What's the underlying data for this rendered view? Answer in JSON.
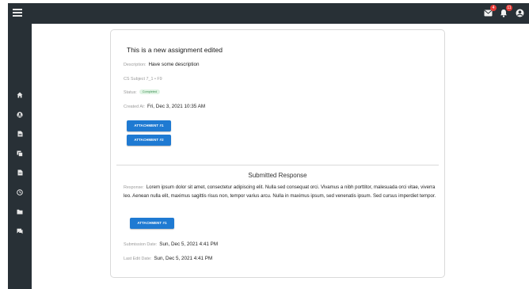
{
  "topbar": {
    "menu_icon": "hamburger-menu-icon",
    "icons": [
      {
        "name": "mail-icon",
        "badge": "4"
      },
      {
        "name": "bell-icon",
        "badge": "11"
      },
      {
        "name": "account-icon",
        "badge": ""
      }
    ],
    "background": "#283036"
  },
  "sidebar": {
    "items": [
      "home-icon",
      "account-circle-icon",
      "document-icon",
      "copy-icon",
      "file-icon",
      "clock-icon",
      "folder-icon",
      "chat-icon"
    ]
  },
  "assignment": {
    "title": "This is a new assignment edited",
    "description_label": "Description:",
    "description": "Have some description",
    "subject": "CS Subject 7_1 • F9",
    "status_label": "Status:",
    "status": "Completed",
    "created_label": "Created At:",
    "created": "Fri, Dec 3, 2021 10:35 AM",
    "attachments": [
      "ATTACHMENT #1",
      "ATTACHMENT #2"
    ]
  },
  "submission": {
    "heading": "Submitted Response",
    "response_label": "Response:",
    "response": "Lorem ipsum dolor sit amet, consectetur adipiscing elit. Nulla sed consequat orci. Vivamus a nibh porttitor, malesuada orci vitae, viverra leo. Aenean nulla elit, maximus sagittis risus non, tempor varius arcu. Nulla in maximus ipsum, sed venenatis ipsum. Sed cursus imperdiet tempor.",
    "attachment": "ATTACHMENT #1",
    "submission_date_label": "Submission Date:",
    "submission_date": "Sun, Dec 5, 2021 4:41 PM",
    "last_edit_label": "Last Edit Date:",
    "last_edit": "Sun, Dec 5, 2021 4:41 PM"
  },
  "colors": {
    "button": "#1f7ad2",
    "chip_bg": "#dff3e3",
    "chip_text": "#3c8f52"
  }
}
